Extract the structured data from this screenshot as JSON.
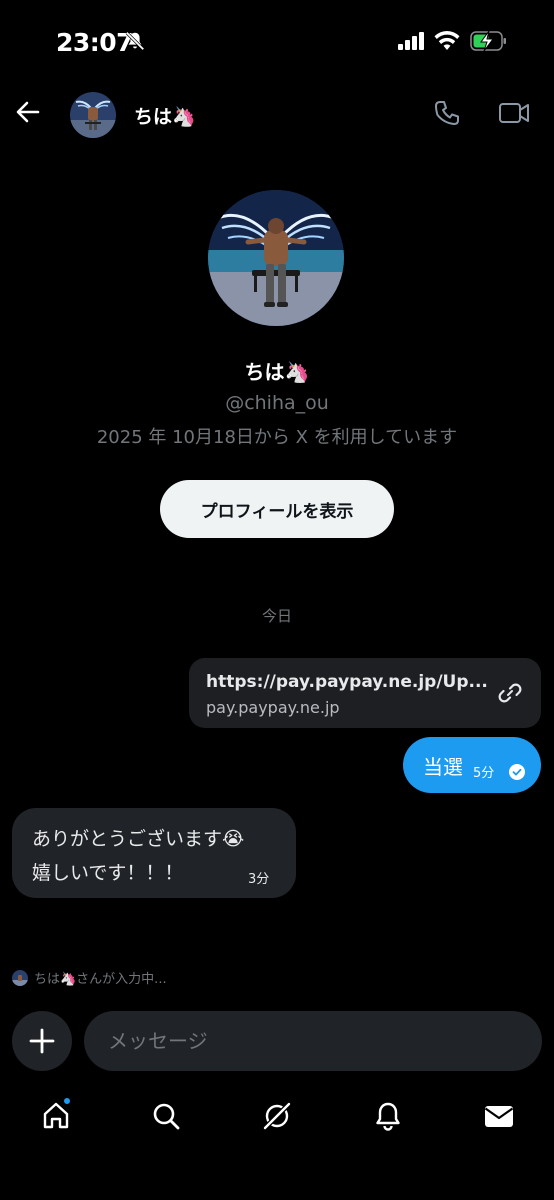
{
  "status_bar": {
    "time": "23:07"
  },
  "header": {
    "name": "ちは🦄"
  },
  "profile": {
    "name": "ちは🦄",
    "handle": "@chiha_ou",
    "joined": "2025 年 10月18日から X を利用しています",
    "view_profile_label": "プロフィールを表示"
  },
  "conversation": {
    "day_label": "今日",
    "link_card": {
      "url": "https://pay.paypay.ne.jp/Up...",
      "domain": "pay.paypay.ne.jp"
    },
    "sent_message": {
      "text": "当選",
      "time": "5分"
    },
    "received_message": {
      "line1": "ありがとうございます😭",
      "line2": "嬉しいです！！！",
      "time": "3分"
    },
    "typing_indicator": "ちは🦄さんが入力中..."
  },
  "composer": {
    "placeholder": "メッセージ"
  },
  "nav": {
    "items": [
      "home-icon",
      "search-icon",
      "grok-icon",
      "notifications-icon",
      "messages-icon"
    ],
    "home_badge": true
  },
  "colors": {
    "accent": "#1d9bf0",
    "background": "#000000",
    "bubble_received": "#202327",
    "button_light": "#eff3f4"
  }
}
